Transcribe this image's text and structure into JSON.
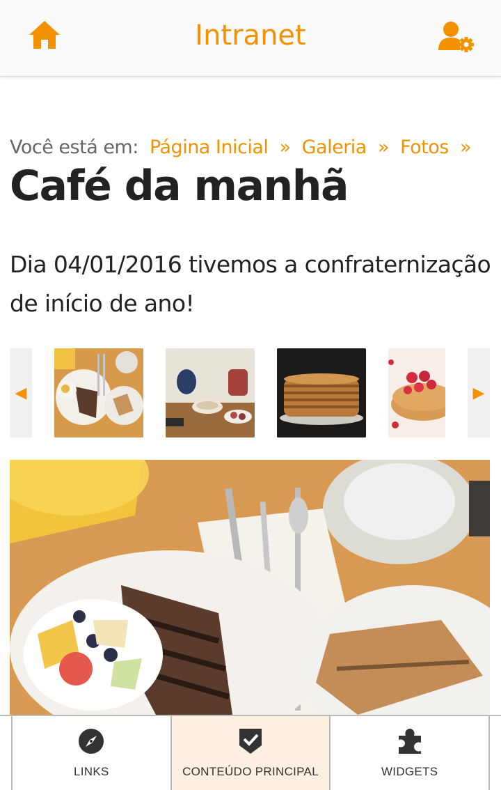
{
  "header": {
    "title": "Intranet",
    "home_icon": "home-icon",
    "user_icon": "user-settings-icon",
    "accent_color": "#f39200"
  },
  "breadcrumb": {
    "prefix": "Você está em:",
    "items": [
      "Página Inicial",
      "Galeria",
      "Fotos"
    ],
    "separator": "»"
  },
  "page": {
    "title": "Café da manhã",
    "description": "Dia 04/01/2016 tivemos a confraternização de início de ano!"
  },
  "gallery": {
    "prev_icon": "◀",
    "next_icon": "▶",
    "selected_index": 0,
    "thumbnails": [
      "breakfast-plate",
      "tea-table",
      "pancake-stack",
      "berry-pancakes"
    ]
  },
  "bottom_nav": {
    "items": [
      {
        "label": "LINKS",
        "icon": "compass-icon"
      },
      {
        "label": "CONTEÚDO PRINCIPAL",
        "icon": "shield-check-icon"
      },
      {
        "label": "WIDGETS",
        "icon": "puzzle-icon"
      }
    ],
    "active_index": 1
  }
}
